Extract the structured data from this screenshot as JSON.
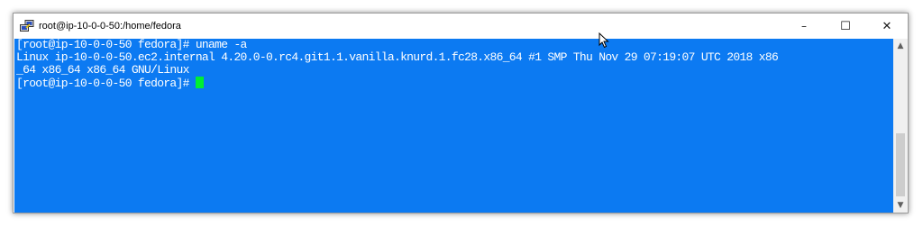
{
  "window": {
    "title": "root@ip-10-0-0-50:/home/fedora",
    "icon": "putty-icon",
    "controls": {
      "minimize": "–",
      "maximize": "☐",
      "close": "✕"
    }
  },
  "terminal": {
    "background": "#0c7af2",
    "foreground": "#ffffff",
    "cursor_color": "#00ee33",
    "lines": [
      "[root@ip-10-0-0-50 fedora]# uname -a",
      "Linux ip-10-0-0-50.ec2.internal 4.20.0-0.rc4.git1.1.vanilla.knurd.1.fc28.x86_64 #1 SMP Thu Nov 29 07:19:07 UTC 2018 x86",
      "_64 x86_64 x86_64 GNU/Linux"
    ],
    "prompt": "[root@ip-10-0-0-50 fedora]# "
  },
  "scrollbar": {
    "up_arrow": "▲",
    "down_arrow": "▼"
  }
}
